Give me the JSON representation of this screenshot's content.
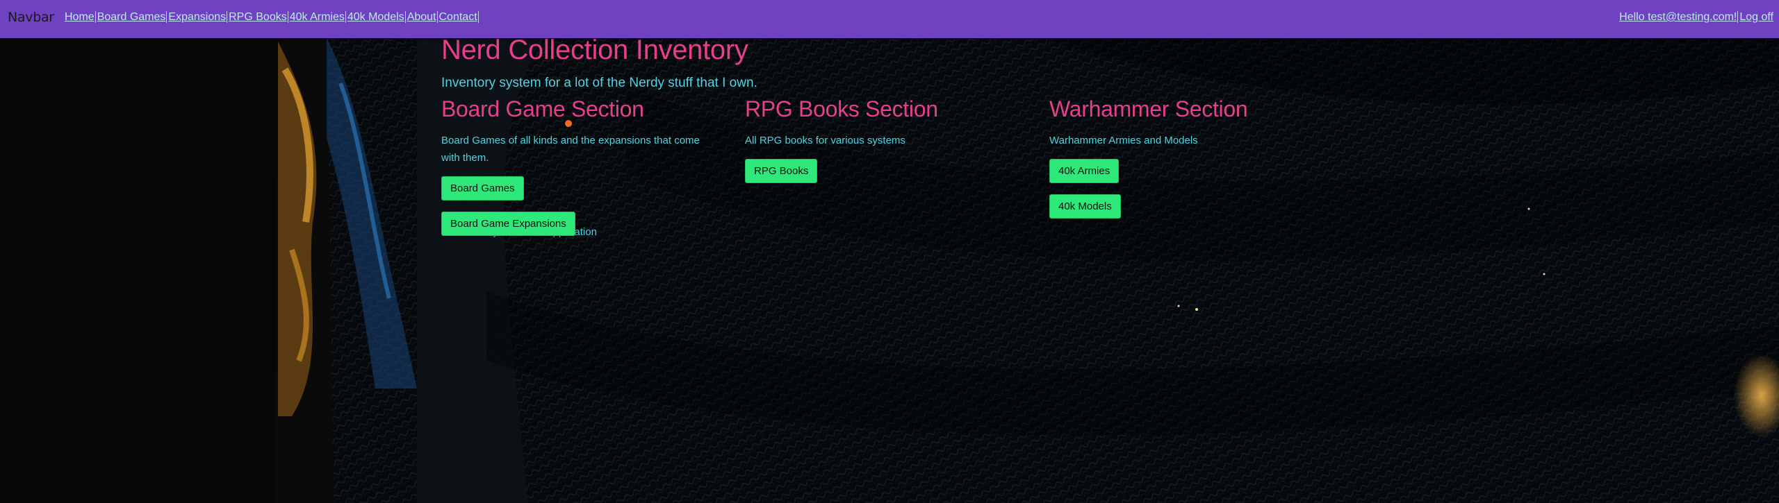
{
  "navbar": {
    "brand": "Navbar",
    "links": [
      "Home",
      "Board Games",
      "Expansions",
      "RPG Books",
      "40k Armies",
      "40k Models",
      "About",
      "Contact"
    ],
    "greeting": "Hello test@testing.com!",
    "logoff": "Log off"
  },
  "main": {
    "title": "Nerd Collection Inventory",
    "lead": "Inventory system for a lot of the Nerdy stuff that I own.",
    "sections": [
      {
        "heading": "Board Game Section",
        "desc": "Board Games of all kinds and the expansions that come with them.",
        "buttons": [
          "Board Games",
          "Board Game Expansions"
        ]
      },
      {
        "heading": "RPG Books Section",
        "desc": "All RPG books for various systems",
        "buttons": [
          "RPG Books"
        ]
      },
      {
        "heading": "Warhammer Section",
        "desc": "Warhammer Armies and Models",
        "buttons": [
          "40k Armies",
          "40k Models"
        ]
      }
    ],
    "footer": "© 2022 - My ASP.NET Application"
  },
  "colors": {
    "navbar": "#6f42c1",
    "heading": "#e83e8c",
    "text": "#4fd3e0",
    "button": "#2ee879",
    "link": "#bfe9f2"
  }
}
